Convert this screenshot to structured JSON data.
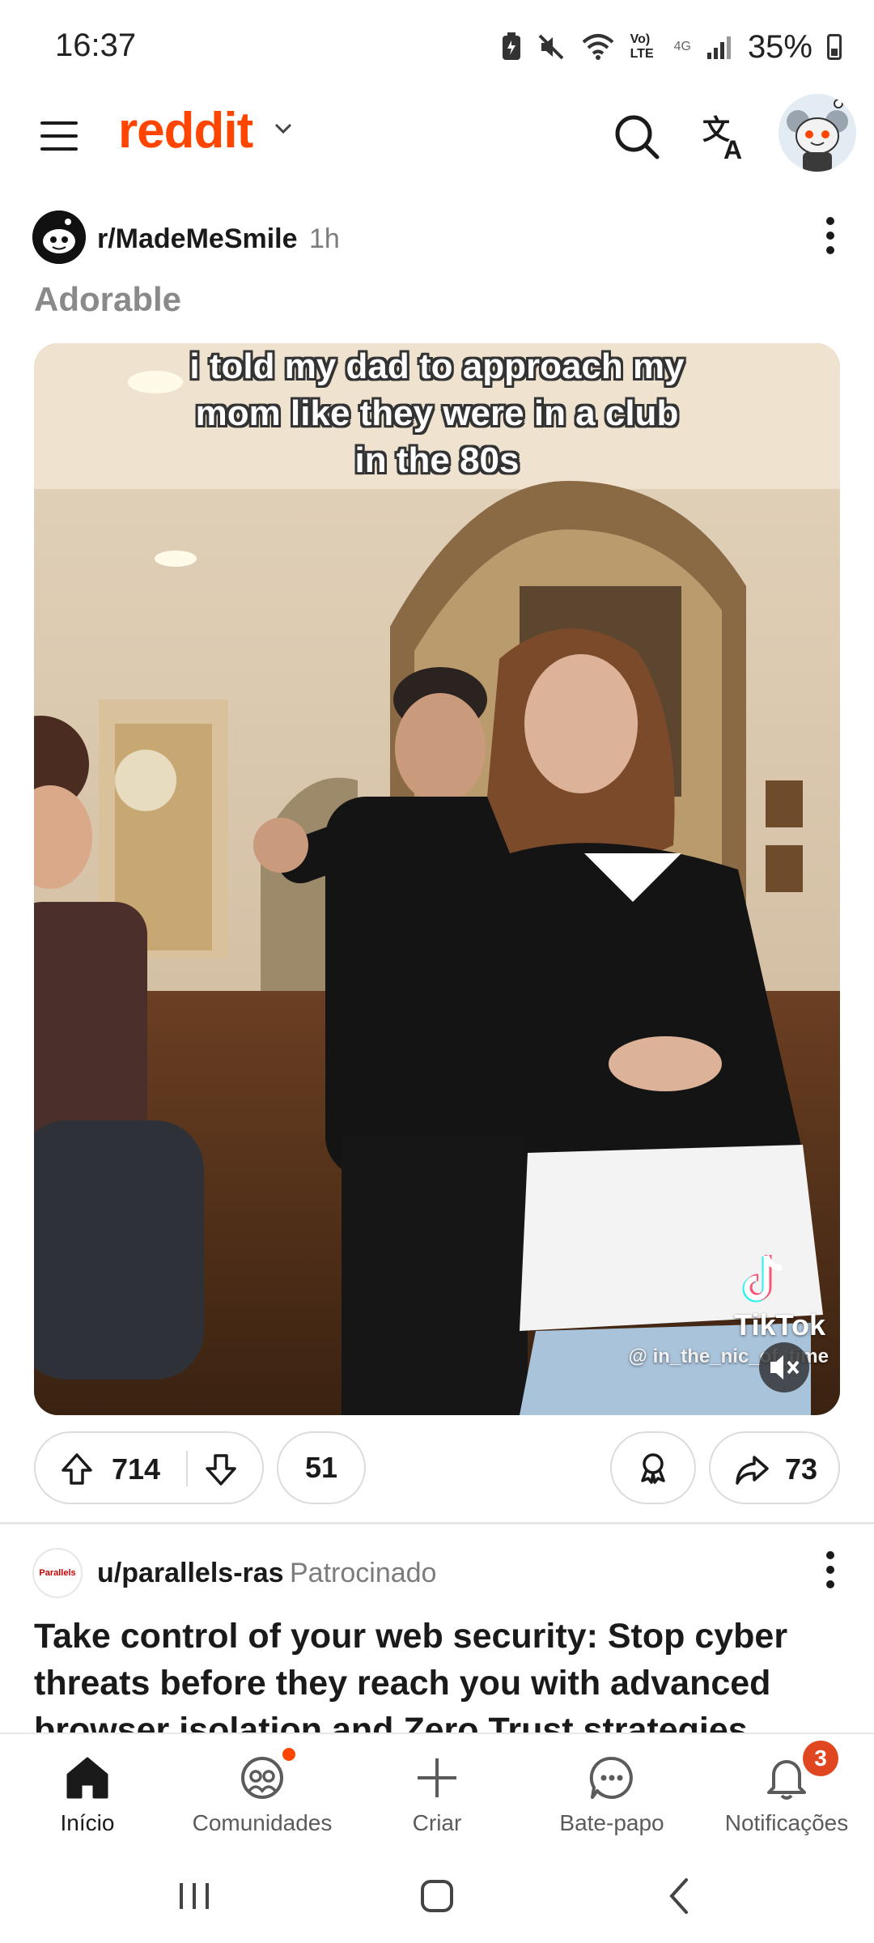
{
  "status_bar": {
    "time": "16:37",
    "signal_label": "Vo) LTE",
    "network_label": "4G",
    "battery": "35%"
  },
  "header": {
    "logo": "reddit",
    "brand_color": "#ff4500"
  },
  "post": {
    "subreddit": "r/MadeMeSmile",
    "age": "1h",
    "title": "Adorable",
    "video": {
      "caption_lines": [
        "i told my dad to approach my",
        "mom like they were in a club",
        "in the 80s"
      ],
      "watermark": "TikTok",
      "handle": "@ in_the_nic_of_time",
      "muted": true
    },
    "actions": {
      "upvotes": "714",
      "comments": "51",
      "shares": "73"
    }
  },
  "sponsored_post": {
    "avatar_text": "Parallels",
    "user": "u/parallels-ras",
    "label": "Patrocinado",
    "title": "Take control of your web security: Stop cyber threats before they reach you with advanced browser isolation and Zero Trust strategies"
  },
  "bottom_nav": {
    "items": [
      {
        "label": "Início",
        "icon": "home-icon",
        "active": true
      },
      {
        "label": "Comunidades",
        "icon": "communities-icon",
        "has_dot": true
      },
      {
        "label": "Criar",
        "icon": "plus-icon"
      },
      {
        "label": "Bate-papo",
        "icon": "chat-icon"
      },
      {
        "label": "Notificações",
        "icon": "bell-icon",
        "badge": "3"
      }
    ]
  }
}
